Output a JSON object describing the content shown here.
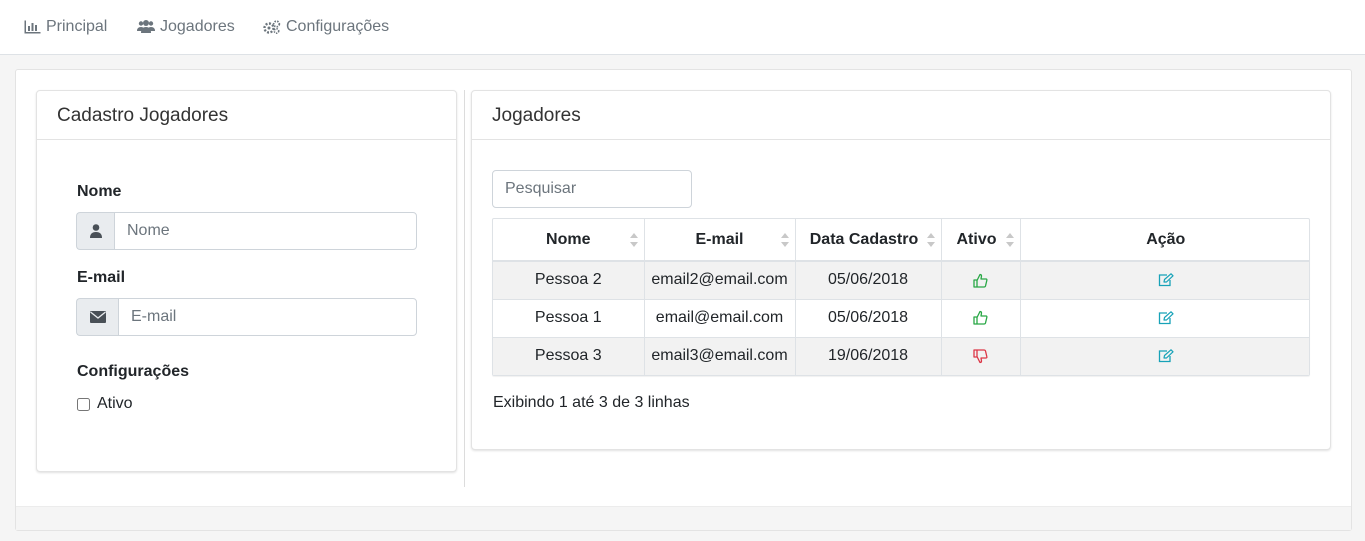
{
  "nav": {
    "items": [
      {
        "label": "Principal",
        "icon": "bar-chart-icon"
      },
      {
        "label": "Jogadores",
        "icon": "users-icon"
      },
      {
        "label": "Configurações",
        "icon": "cogs-icon"
      }
    ]
  },
  "form_panel": {
    "title": "Cadastro Jogadores",
    "name_label": "Nome",
    "name_placeholder": "Nome",
    "name_icon": "user-icon",
    "email_label": "E-mail",
    "email_placeholder": "E-mail",
    "email_icon": "envelope-icon",
    "config_label": "Configurações",
    "active_label": "Ativo",
    "active_checked": false
  },
  "table_panel": {
    "title": "Jogadores",
    "search_placeholder": "Pesquisar",
    "columns": [
      "Nome",
      "E-mail",
      "Data Cadastro",
      "Ativo",
      "Ação"
    ],
    "rows": [
      {
        "nome": "Pessoa 2",
        "email": "email2@email.com",
        "data": "05/06/2018",
        "ativo": true
      },
      {
        "nome": "Pessoa 1",
        "email": "email@email.com",
        "data": "05/06/2018",
        "ativo": true
      },
      {
        "nome": "Pessoa 3",
        "email": "email3@email.com",
        "data": "19/06/2018",
        "ativo": false
      }
    ],
    "footer": "Exibindo 1 até 3 de 3 linhas",
    "active_icon": "thumbs-up-icon",
    "inactive_icon": "thumbs-down-icon",
    "action_icon": "edit-icon"
  },
  "colors": {
    "active": "#28a745",
    "inactive": "#dc3545",
    "action": "#17a2b8",
    "nav_text": "#6c757d"
  }
}
